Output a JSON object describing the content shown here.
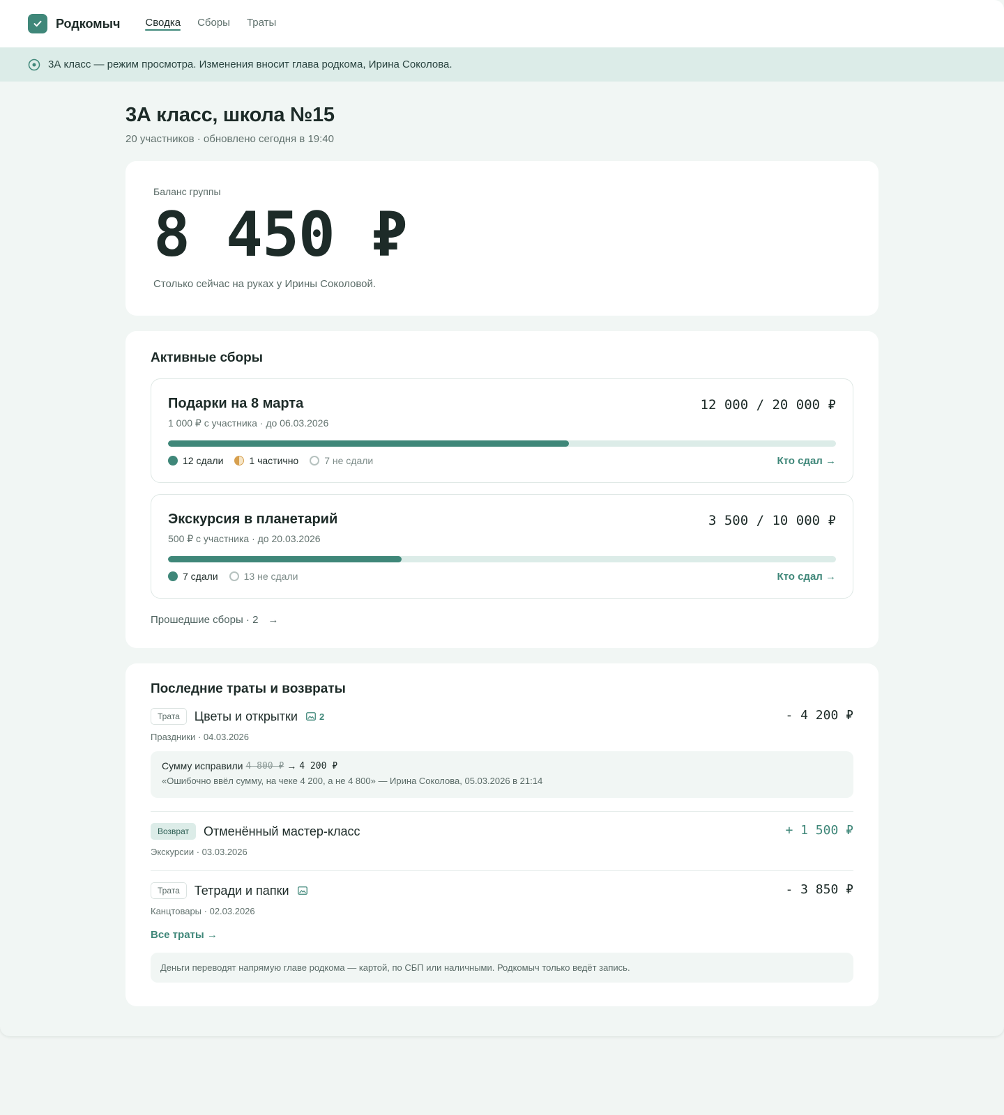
{
  "app": {
    "name": "Родкомыч",
    "accent_color": "#3f8779",
    "logo_icon": "check-icon"
  },
  "nav": {
    "tabs": [
      {
        "label": "Сводка",
        "active": true
      },
      {
        "label": "Сборы",
        "active": false
      },
      {
        "label": "Траты",
        "active": false
      }
    ]
  },
  "notice": {
    "icon": "eye-circle-icon",
    "text": "3А класс — режим просмотра. Изменения вносит глава родкома, Ирина Соколова."
  },
  "page": {
    "title": "3А класс, школа №15",
    "meta": "20 участников · обновлено сегодня в 19:40"
  },
  "balance": {
    "label": "Баланс группы",
    "amount": "8 450 ₽",
    "note": "Столько сейчас на руках у Ирины Соколовой."
  },
  "goals": {
    "title": "Активные сборы",
    "items": [
      {
        "name": "Подарки на 8 марта",
        "sum": "12 000 / 20 000 ₽",
        "meta": "1 000 ₽ с участника · до 06.03.2026",
        "progress": 0.6,
        "paid": "12 сдали",
        "partial": "1 частично",
        "unpaid": "7 не сдали",
        "link": "Кто сдал →"
      },
      {
        "name": "Экскурсия в планетарий",
        "sum": "3 500 / 10 000 ₽",
        "meta": "500 ₽ с участника · до 20.03.2026",
        "progress": 0.35,
        "paid": "7 сдали",
        "unpaid": "13 не сдали",
        "link": "Кто сдал →"
      }
    ],
    "past_link": "Прошедшие сборы · 2",
    "past_arrow": "→"
  },
  "spending": {
    "title": "Последние траты и возвраты",
    "items": [
      {
        "tag": "Трата",
        "title": "Цветы и открытки",
        "attachments": "2",
        "amount": "- 4 200 ₽",
        "meta": "Праздники · 04.03.2026",
        "correction": {
          "label": "Сумму исправили",
          "old": "4 800 ₽",
          "arrow": "→",
          "new": "4 200 ₽",
          "quote": "«Ошибочно ввёл сумму, на чеке 4 200, а не 4 800» — Ирина Соколова, 05.03.2026 в 21:14"
        }
      },
      {
        "tag": "Возврат",
        "title": "Отменённый мастер-класс",
        "amount": "+ 1 500 ₽",
        "meta": "Экскурсии · 03.03.2026"
      },
      {
        "tag": "Трата",
        "title": "Тетради и папки",
        "amount": "- 3 850 ₽",
        "meta": "Канцтовары · 02.03.2026"
      }
    ],
    "all_link": "Все траты →",
    "footnote": "Деньги переводят напрямую главе родкома — картой, по СБП или наличными. Родкомыч только ведёт запись."
  }
}
